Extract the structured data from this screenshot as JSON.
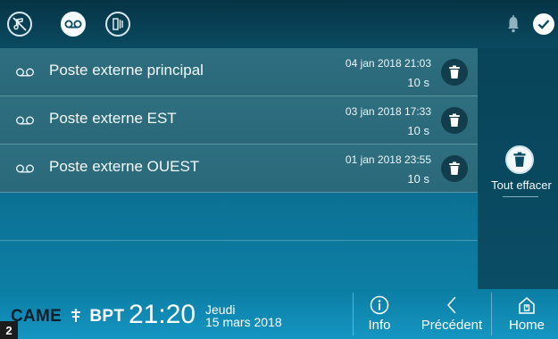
{
  "topbar": {
    "icons": [
      "mute-note-icon",
      "voicemail-icon",
      "door-open-icon"
    ],
    "active_icon": "voicemail-icon",
    "right_icons": [
      "bell-icon",
      "check-icon"
    ]
  },
  "messages": [
    {
      "name": "Poste externe principal",
      "date": "04 jan 2018 21:03",
      "duration": "10 s"
    },
    {
      "name": "Poste externe EST",
      "date": "03 jan 2018 17:33",
      "duration": "10 s"
    },
    {
      "name": "Poste externe OUEST",
      "date": "01 jan 2018 23:55",
      "duration": "10 s"
    }
  ],
  "side": {
    "clear_all_label": "Tout effacer"
  },
  "bottom": {
    "brand_came": "CAME",
    "brand_bpt": "BPT",
    "time": "21:20",
    "day": "Jeudi",
    "date": "15 mars 2018",
    "info_label": "Info",
    "previous_label": "Précédent",
    "home_label": "Home"
  },
  "figure_number": "2",
  "colors": {
    "accent": "#0d5b78",
    "topbar": "#063445",
    "bottombar": "#1596c2"
  }
}
